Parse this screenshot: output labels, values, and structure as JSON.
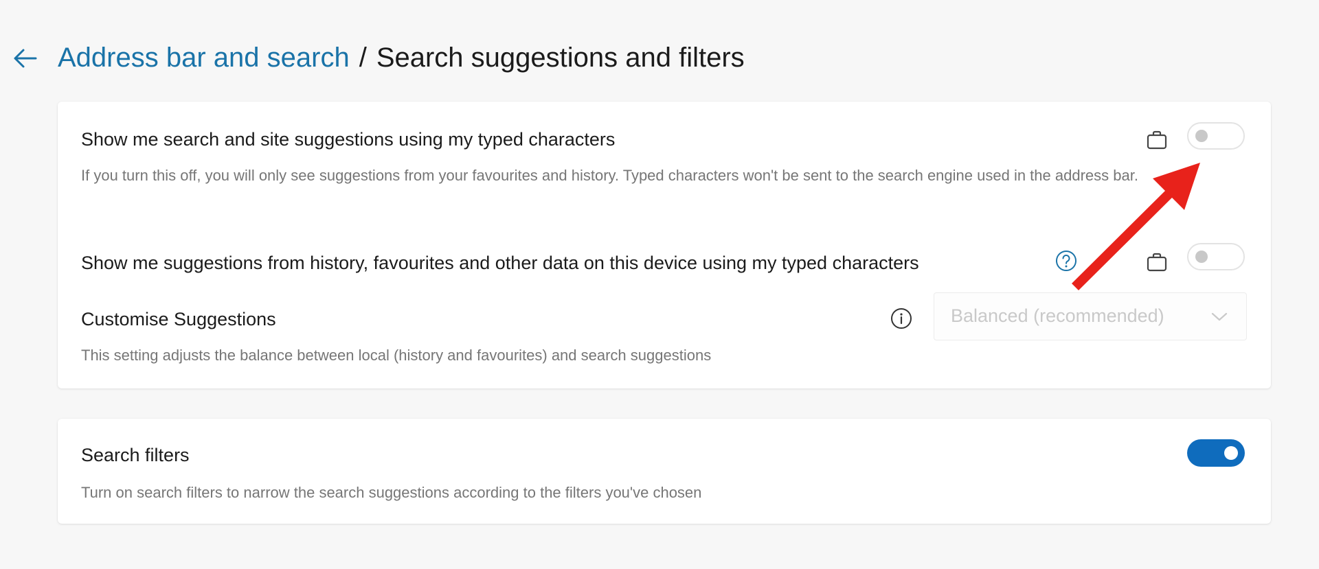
{
  "header": {
    "back_icon": "back-arrow-icon",
    "breadcrumb_parent": "Address bar and search",
    "breadcrumb_separator": "/",
    "breadcrumb_current": "Search suggestions and filters"
  },
  "card1": {
    "setting1": {
      "title": "Show me search and site suggestions using my typed characters",
      "description": "If you turn this off, you will only see suggestions from your favourites and history. Typed characters won't be sent to the search engine used in the address bar.",
      "enabled": false,
      "policy_icon": "briefcase-icon"
    },
    "setting2": {
      "title": "Show me suggestions from history, favourites and other data on this device using my typed characters",
      "help_icon": "help-icon",
      "enabled": false,
      "policy_icon": "briefcase-icon"
    },
    "setting3": {
      "title": "Customise Suggestions",
      "description": "This setting adjusts the balance between local (history and favourites) and search suggestions",
      "info_icon": "info-icon",
      "dropdown_value": "Balanced (recommended)",
      "dropdown_disabled": true
    }
  },
  "card2": {
    "title": "Search filters",
    "description": "Turn on search filters to narrow the search suggestions according to the filters you've chosen",
    "enabled": true
  },
  "colors": {
    "accent": "#0f6cbd",
    "link": "#1a73a8",
    "annotation": "#e8221b"
  }
}
